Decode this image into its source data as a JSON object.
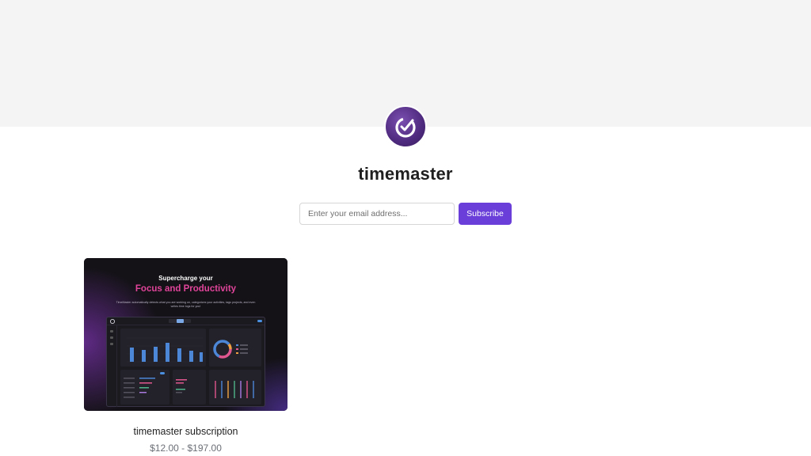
{
  "brand": {
    "name": "timemaster",
    "logo_icon": "clock-check-icon"
  },
  "subscribe_form": {
    "email_placeholder": "Enter your email address...",
    "button_label": "Subscribe",
    "button_color": "#6a3fd9"
  },
  "products": [
    {
      "title": "timemaster subscription",
      "price": "$12.00 - $197.00",
      "thumbnail": {
        "headline": "Supercharge your",
        "highlight": "Focus and Productivity",
        "highlight_color": "#e0449a",
        "subtitle": "TimeMaster automatically detects what you are working on, categorizes your activities, tags projects, and even writes time logs for you!"
      }
    }
  ]
}
